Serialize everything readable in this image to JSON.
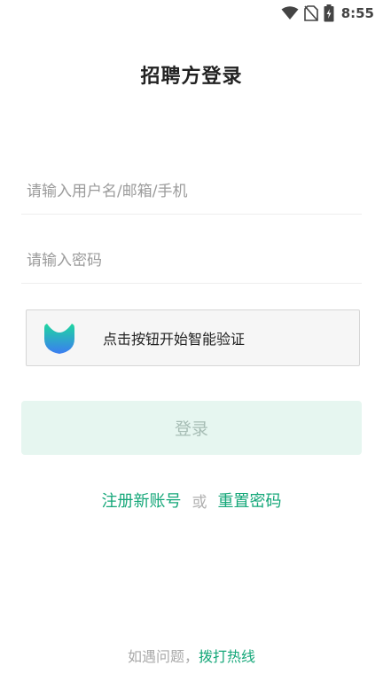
{
  "status_bar": {
    "time": "8:55",
    "icons": [
      "wifi-icon",
      "no-sim-icon",
      "battery-charging-icon"
    ]
  },
  "title": "招聘方登录",
  "form": {
    "username_placeholder": "请输入用户名/邮箱/手机",
    "username_value": "",
    "password_placeholder": "请输入密码",
    "password_value": ""
  },
  "captcha": {
    "text": "点击按钮开始智能验证",
    "icon": "captcha-shield-icon"
  },
  "login_button": "登录",
  "links": {
    "register": "注册新账号",
    "or": "或",
    "reset_password": "重置密码"
  },
  "footer": {
    "prefix": "如遇问题，",
    "hotline": "拨打热线"
  },
  "colors": {
    "accent": "#15a779",
    "login_button_bg": "#e6f6f0",
    "login_button_text": "#a7bdb5",
    "captcha_gradient_top": "#1fd6a0",
    "captcha_gradient_bottom": "#3b7cf2"
  }
}
